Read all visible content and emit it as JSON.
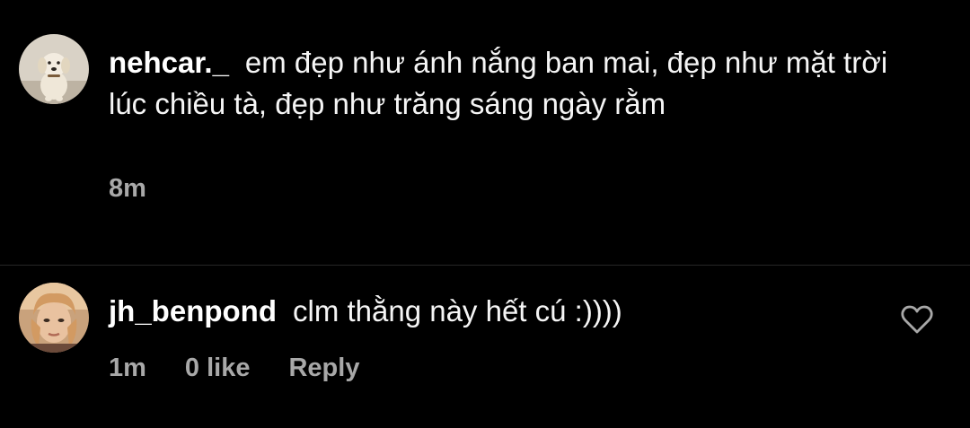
{
  "comments": [
    {
      "username": "nehcar._",
      "text": "em đẹp như ánh nắng ban mai, đẹp như mặt trời lúc chiều tà, đẹp như trăng sáng ngày rằm",
      "time": "8m",
      "avatar_icon": "puppy-avatar"
    },
    {
      "username": "jh_benpond",
      "text": "clm thằng này hết cú :))))",
      "time": "1m",
      "likes": "0 like",
      "reply_label": "Reply",
      "avatar_icon": "person-avatar",
      "like_icon": "heart-outline-icon"
    }
  ],
  "colors": {
    "background": "#000000",
    "text": "#f5f5f5",
    "secondary_text": "#a8a8a8",
    "divider": "#262626"
  }
}
